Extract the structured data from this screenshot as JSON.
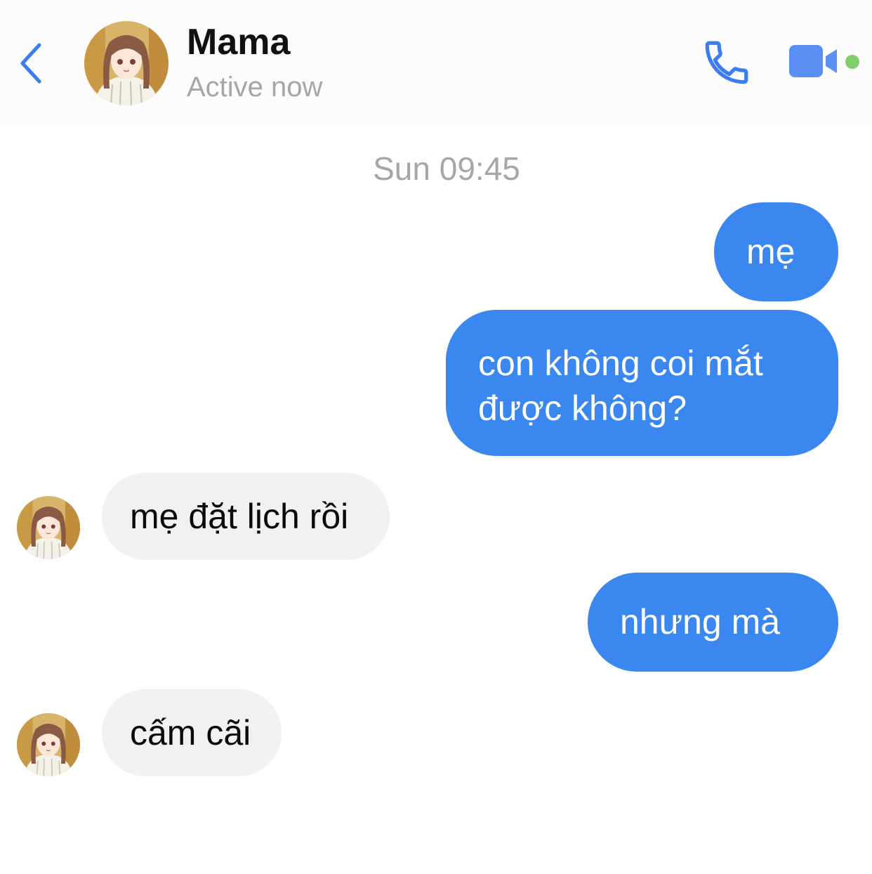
{
  "header": {
    "back_icon": "chevron-left-icon",
    "contact_name": "Mama",
    "status": "Active now",
    "call_icon": "phone-icon",
    "video_icon": "video-camera-icon",
    "online_indicator_color": "#7fce6b"
  },
  "conversation": {
    "timestamp": "Sun 09:45",
    "messages": [
      {
        "direction": "outgoing",
        "lines": [
          "mẹ"
        ]
      },
      {
        "direction": "outgoing",
        "lines": [
          "con không coi mắt",
          "được không?"
        ]
      },
      {
        "direction": "incoming",
        "lines": [
          "mẹ đặt lịch rồi"
        ]
      },
      {
        "direction": "outgoing",
        "lines": [
          "nhưng mà"
        ]
      },
      {
        "direction": "incoming",
        "lines": [
          "cấm cãi"
        ]
      }
    ]
  },
  "colors": {
    "outgoing_bubble": "#3a87ef",
    "incoming_bubble": "#f1f1f1",
    "accent": "#3b7cf0",
    "secondary_text": "#a6a6a6"
  }
}
